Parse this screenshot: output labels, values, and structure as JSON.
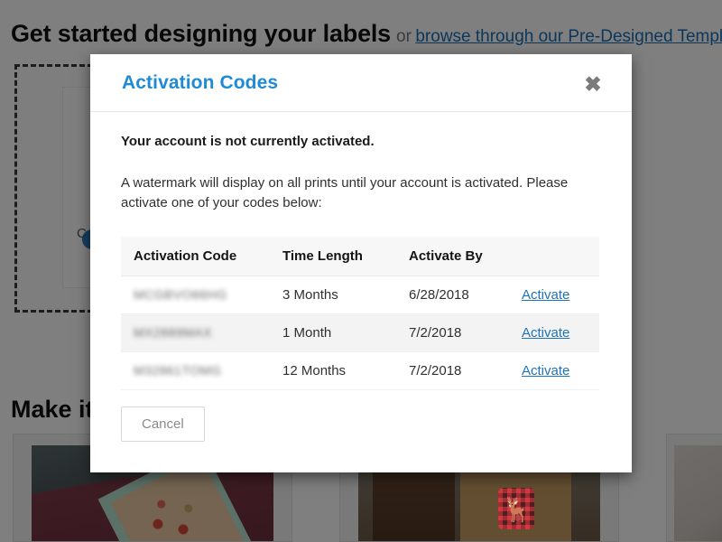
{
  "background": {
    "hero_heading_main": "Get started designing your labels",
    "hero_heading_or": "or",
    "hero_heading_link": "browse through our Pre-Designed Templa",
    "dropzone_label": "C",
    "lower_heading": "Make it",
    "product_cards": [
      {
        "name": "floral-card-photo"
      },
      {
        "name": "kraft-gift-bag-photo"
      },
      {
        "name": "rose-decor-photo"
      }
    ]
  },
  "modal": {
    "title": "Activation Codes",
    "close_label": "✖",
    "alert_text": "Your account is not currently activated.",
    "description": "A watermark will display on all prints until your account is activated. Please activate one of your codes below:",
    "table": {
      "headers": [
        "Activation Code",
        "Time Length",
        "Activate By",
        ""
      ],
      "rows": [
        {
          "code": "MCGBVO66HG",
          "time_length": "3 Months",
          "activate_by": "6/28/2018",
          "action_label": "Activate"
        },
        {
          "code": "MX2889MAX",
          "time_length": "1 Month",
          "activate_by": "7/2/2018",
          "action_label": "Activate"
        },
        {
          "code": "M32861TOMG",
          "time_length": "12 Months",
          "activate_by": "7/2/2018",
          "action_label": "Activate"
        }
      ]
    },
    "cancel_label": "Cancel"
  },
  "colors": {
    "modal_title": "#1f8ad6",
    "link": "#1f73b8",
    "overlay": "rgba(0,0,0,0.5)",
    "table_header_bg": "#f7f7f7",
    "row_stripe_bg": "#f3f3f3"
  }
}
